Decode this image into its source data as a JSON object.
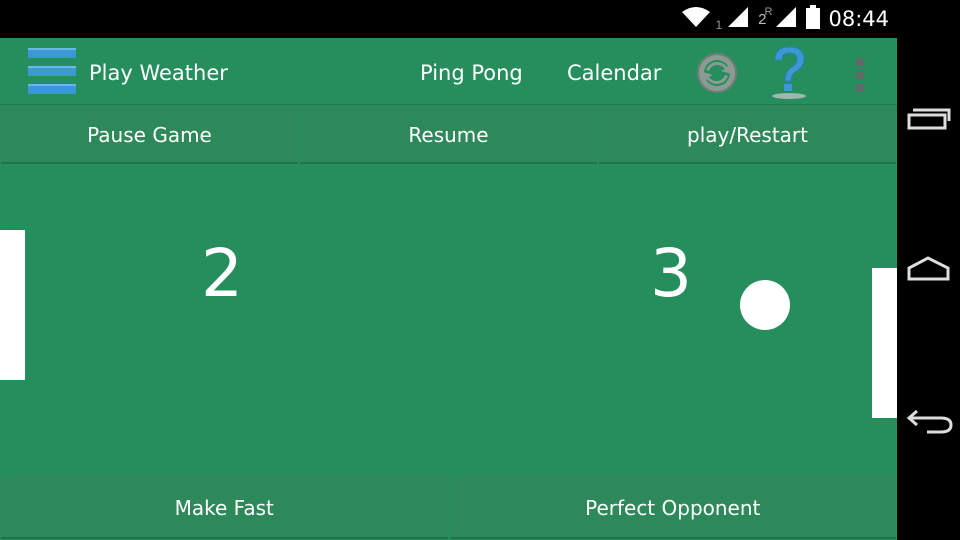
{
  "status_bar": {
    "sim1_label": "1",
    "sim2_label": "2",
    "roaming_label": "R",
    "time": "08:44",
    "icons": [
      "wifi-icon",
      "signal-icon",
      "signal-icon",
      "battery-icon"
    ]
  },
  "action_bar": {
    "title": "Play Weather",
    "nav": [
      "Ping Pong",
      "Calendar"
    ],
    "icons": [
      "menu-icon",
      "refresh-icon",
      "help-icon",
      "overflow-menu-icon"
    ]
  },
  "controls": {
    "pause": "Pause Game",
    "resume": "Resume",
    "play_restart": "play/Restart"
  },
  "game": {
    "left_score": "2",
    "right_score": "3"
  },
  "bottom_controls": {
    "make_fast": "Make Fast",
    "perfect_opponent": "Perfect Opponent"
  },
  "system_nav": [
    "recents-icon",
    "home-icon",
    "back-icon"
  ],
  "colors": {
    "background": "#258e5c",
    "button": "#2d895a",
    "accent_blue": "#3a98d4"
  }
}
